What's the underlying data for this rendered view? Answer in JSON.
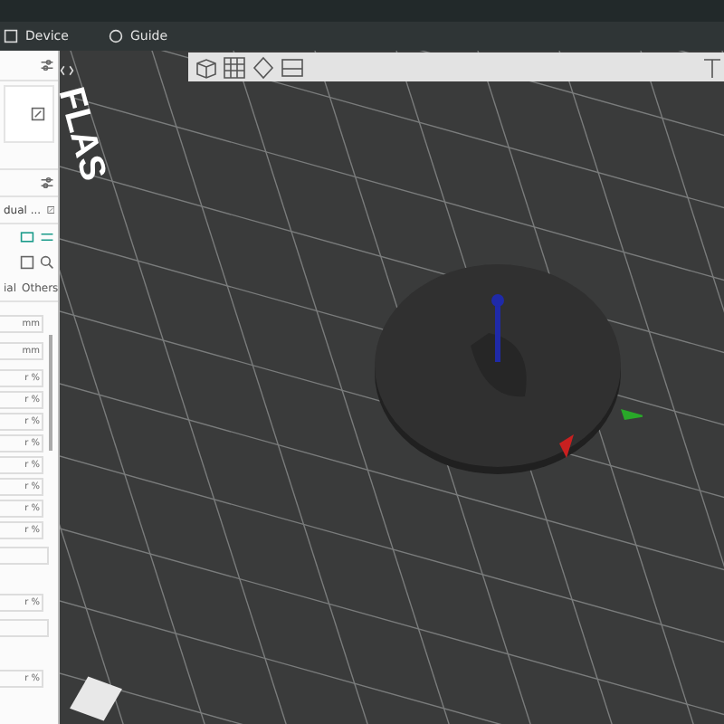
{
  "menu": [
    {
      "label": "Device"
    },
    {
      "label": "Guide"
    }
  ],
  "panel": {
    "profile_label": "dual ...",
    "tabs": [
      {
        "label": "ial",
        "selected": false
      },
      {
        "label": "Others",
        "selected": false
      }
    ],
    "rows": [
      {
        "unit": "mm"
      },
      {
        "unit": "mm"
      },
      {
        "unit": "r %"
      },
      {
        "unit": "r %"
      },
      {
        "unit": "r %"
      },
      {
        "unit": "r %"
      },
      {
        "unit": "r %"
      },
      {
        "unit": "r %"
      },
      {
        "unit": "r %"
      },
      {
        "unit": "r %"
      }
    ],
    "bottom_rows": [
      {
        "unit": "r %"
      },
      {
        "unit": "r %"
      }
    ]
  },
  "viewport": {
    "plate_logo": "FLAS"
  }
}
